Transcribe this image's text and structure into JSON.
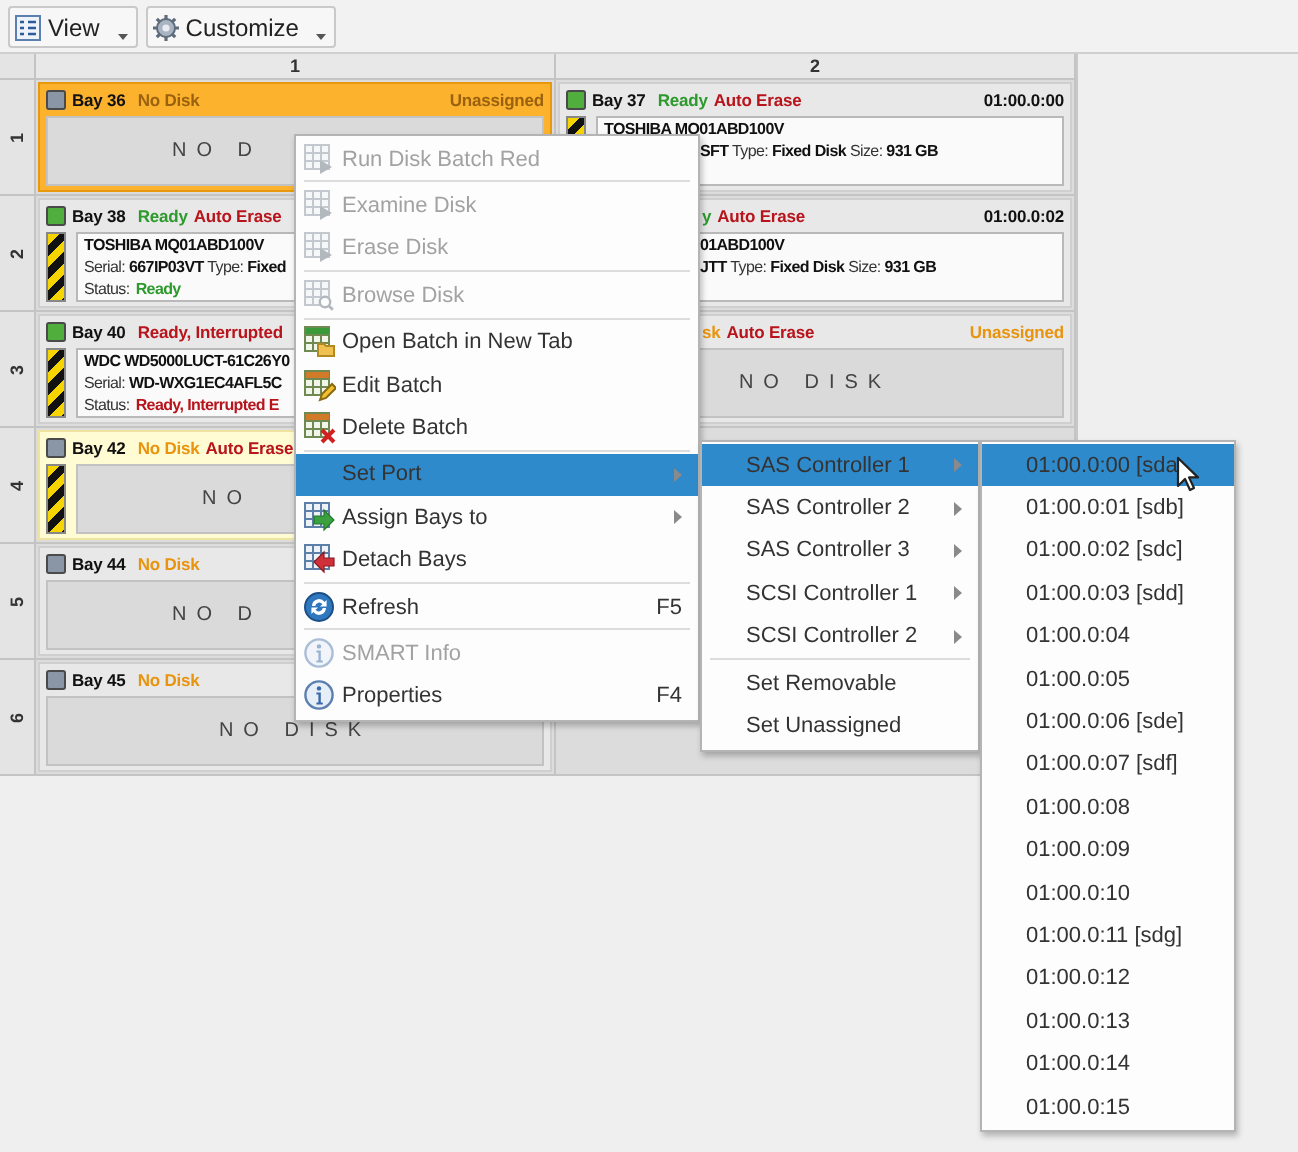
{
  "toolbar": {
    "buttons": [
      {
        "label": "View",
        "kind": "list",
        "has_dropdown": true
      },
      {
        "label": "Customize",
        "kind": "gear",
        "has_dropdown": true
      }
    ]
  },
  "grid": {
    "columns": [
      "1",
      "2"
    ],
    "rows": [
      {
        "label": "1",
        "cells": [
          {
            "selected": true,
            "highlighted": false,
            "color": "#8a96a6",
            "bay": "Bay 36",
            "status": [
              {
                "text": "No Disk",
                "color": "#9a6210"
              }
            ],
            "right": {
              "text": "Unassigned",
              "color": "#9a6210"
            },
            "striped": false,
            "body": {
              "kind": "empty",
              "label": "NO D"
            }
          },
          {
            "selected": false,
            "highlighted": false,
            "color": "#4fae3c",
            "bay": "Bay 37",
            "status": [
              {
                "text": "Ready",
                "color": "#2d9a2d"
              },
              {
                "text": "Auto Erase",
                "color": "#b8141c"
              }
            ],
            "right": {
              "text": "01:00.0:00",
              "color": "#111111"
            },
            "striped": true,
            "body": {
              "kind": "disk",
              "model": "TOSHIBA MQ01ABD100V",
              "details": "**SFT** Type: **Fixed Disk**  Size: **931 GB**"
            }
          }
        ]
      },
      {
        "label": "2",
        "cells": [
          {
            "selected": false,
            "highlighted": false,
            "color": "#4fae3c",
            "bay": "Bay 38",
            "status": [
              {
                "text": "Ready",
                "color": "#2d9a2d"
              },
              {
                "text": "Auto Erase",
                "color": "#b8141c"
              }
            ],
            "striped": true,
            "body": {
              "kind": "disk",
              "model": "TOSHIBA MQ01ABD100V",
              "details": "Serial: **667IP03VT** Type: **Fixed**",
              "status_label": "Status:",
              "status_value": {
                "text": "Ready",
                "color": "#2d9a2d"
              }
            }
          },
          {
            "selected": false,
            "highlighted": false,
            "status": [
              {
                "text": "y",
                "color": "#2d9a2d"
              },
              {
                "text": "Auto Erase",
                "color": "#b8141c"
              }
            ],
            "right": {
              "text": "01:00.0:02",
              "color": "#111111"
            },
            "striped": false,
            "body": {
              "kind": "disk",
              "model": "01ABD100V",
              "details": "**JTT** Type: **Fixed Disk**  Size: **931 GB**"
            }
          }
        ]
      },
      {
        "label": "3",
        "cells": [
          {
            "selected": false,
            "highlighted": false,
            "color": "#4fae3c",
            "bay": "Bay 40",
            "status": [
              {
                "text": "Ready, Interrupted",
                "color": "#b8141c"
              }
            ],
            "striped": true,
            "body": {
              "kind": "disk",
              "model": "WDC WD5000LUCT-61C26Y0",
              "details": "Serial: **WD-WXG1EC4AFL5C**",
              "status_label": "Status:",
              "status_value": {
                "text": "Ready, Interrupted E",
                "color": "#b8141c"
              }
            }
          },
          {
            "selected": false,
            "highlighted": false,
            "status": [
              {
                "text": "sk",
                "color": "#e8940e"
              },
              {
                "text": "Auto Erase",
                "color": "#b8141c"
              }
            ],
            "right": {
              "text": "Unassigned",
              "color": "#e8940e"
            },
            "striped": false,
            "body": {
              "kind": "empty",
              "label": "NO DISK"
            }
          }
        ]
      },
      {
        "label": "4",
        "cells": [
          {
            "selected": false,
            "highlighted": true,
            "color": "#8a96a6",
            "bay": "Bay 42",
            "status": [
              {
                "text": "No Disk",
                "color": "#e8940e"
              },
              {
                "text": "Auto Erase",
                "color": "#b8141c"
              }
            ],
            "striped": true,
            "body": {
              "kind": "empty",
              "label": "NO"
            }
          }
        ]
      },
      {
        "label": "5",
        "cells": [
          {
            "selected": false,
            "highlighted": false,
            "color": "#8a96a6",
            "bay": "Bay 44",
            "status": [
              {
                "text": "No Disk",
                "color": "#e8940e"
              }
            ],
            "striped": false,
            "body": {
              "kind": "empty",
              "label": "NO D"
            }
          }
        ]
      },
      {
        "label": "6",
        "cells": [
          {
            "selected": false,
            "highlighted": false,
            "color": "#8a96a6",
            "bay": "Bay 45",
            "status": [
              {
                "text": "No Disk",
                "color": "#e8940e"
              }
            ],
            "striped": false,
            "body": {
              "kind": "empty",
              "label": "NO DISK"
            }
          }
        ]
      }
    ]
  },
  "context_menu": {
    "items": [
      {
        "kind": "play",
        "label": "Run Disk Batch Red",
        "disabled": true,
        "selected": false,
        "has_submenu": false
      },
      {
        "kind": "separator"
      },
      {
        "kind": "play",
        "label": "Examine Disk",
        "disabled": true,
        "selected": false,
        "has_submenu": false
      },
      {
        "kind": "play",
        "label": "Erase Disk",
        "disabled": true,
        "selected": false,
        "has_submenu": false
      },
      {
        "kind": "separator"
      },
      {
        "kind": "browse",
        "label": "Browse Disk",
        "disabled": true,
        "selected": false,
        "has_submenu": false
      },
      {
        "kind": "separator"
      },
      {
        "kind": "folder",
        "label": "Open Batch in New Tab",
        "disabled": false,
        "selected": false,
        "has_submenu": false
      },
      {
        "kind": "pencil",
        "label": "Edit Batch",
        "disabled": false,
        "selected": false,
        "has_submenu": false
      },
      {
        "kind": "delete",
        "label": "Delete Batch",
        "disabled": false,
        "selected": false,
        "has_submenu": false
      },
      {
        "kind": "separator"
      },
      {
        "kind": "plain",
        "label": "Set Port",
        "disabled": false,
        "selected": true,
        "has_submenu": true
      },
      {
        "kind": "assign",
        "label": "Assign Bays to",
        "disabled": false,
        "selected": false,
        "has_submenu": true
      },
      {
        "kind": "detach",
        "label": "Detach Bays",
        "disabled": false,
        "selected": false,
        "has_submenu": false
      },
      {
        "kind": "separator"
      },
      {
        "kind": "refresh",
        "label": "Refresh",
        "shortcut": "F5",
        "disabled": false,
        "selected": false,
        "has_submenu": false
      },
      {
        "kind": "separator"
      },
      {
        "kind": "info",
        "label": "SMART Info",
        "disabled": true,
        "selected": false,
        "has_submenu": false
      },
      {
        "kind": "info",
        "label": "Properties",
        "shortcut": "F4",
        "disabled": false,
        "selected": false,
        "has_submenu": false
      }
    ]
  },
  "port_submenu": {
    "items": [
      {
        "kind": "plain",
        "label": "SAS Controller 1",
        "disabled": false,
        "selected": true,
        "has_submenu": true
      },
      {
        "kind": "plain",
        "label": "SAS Controller 2",
        "disabled": false,
        "selected": false,
        "has_submenu": true
      },
      {
        "kind": "plain",
        "label": "SAS Controller 3",
        "disabled": false,
        "selected": false,
        "has_submenu": true
      },
      {
        "kind": "plain",
        "label": "SCSI Controller 1",
        "disabled": false,
        "selected": false,
        "has_submenu": true
      },
      {
        "kind": "plain",
        "label": "SCSI Controller 2",
        "disabled": false,
        "selected": false,
        "has_submenu": true
      },
      {
        "kind": "separator"
      },
      {
        "kind": "plain",
        "label": "Set Removable",
        "disabled": false,
        "selected": false,
        "has_submenu": false
      },
      {
        "kind": "plain",
        "label": "Set Unassigned",
        "disabled": false,
        "selected": false,
        "has_submenu": false
      }
    ]
  },
  "controller_submenu": {
    "items": [
      {
        "kind": "plain",
        "label": "01:00.0:00 [sda",
        "disabled": false,
        "selected": true,
        "has_submenu": false
      },
      {
        "kind": "plain",
        "label": "01:00.0:01 [sdb]",
        "disabled": false,
        "selected": false,
        "has_submenu": false
      },
      {
        "kind": "plain",
        "label": "01:00.0:02 [sdc]",
        "disabled": false,
        "selected": false,
        "has_submenu": false
      },
      {
        "kind": "plain",
        "label": "01:00.0:03 [sdd]",
        "disabled": false,
        "selected": false,
        "has_submenu": false
      },
      {
        "kind": "plain",
        "label": "01:00.0:04",
        "disabled": false,
        "selected": false,
        "has_submenu": false
      },
      {
        "kind": "plain",
        "label": "01:00.0:05",
        "disabled": false,
        "selected": false,
        "has_submenu": false
      },
      {
        "kind": "plain",
        "label": "01:00.0:06 [sde]",
        "disabled": false,
        "selected": false,
        "has_submenu": false
      },
      {
        "kind": "plain",
        "label": "01:00.0:07 [sdf]",
        "disabled": false,
        "selected": false,
        "has_submenu": false
      },
      {
        "kind": "plain",
        "label": "01:00.0:08",
        "disabled": false,
        "selected": false,
        "has_submenu": false
      },
      {
        "kind": "plain",
        "label": "01:00.0:09",
        "disabled": false,
        "selected": false,
        "has_submenu": false
      },
      {
        "kind": "plain",
        "label": "01:00.0:10",
        "disabled": false,
        "selected": false,
        "has_submenu": false
      },
      {
        "kind": "plain",
        "label": "01:00.0:11 [sdg]",
        "disabled": false,
        "selected": false,
        "has_submenu": false
      },
      {
        "kind": "plain",
        "label": "01:00.0:12",
        "disabled": false,
        "selected": false,
        "has_submenu": false
      },
      {
        "kind": "plain",
        "label": "01:00.0:13",
        "disabled": false,
        "selected": false,
        "has_submenu": false
      },
      {
        "kind": "plain",
        "label": "01:00.0:14",
        "disabled": false,
        "selected": false,
        "has_submenu": false
      },
      {
        "kind": "plain",
        "label": "01:00.0:15",
        "disabled": false,
        "selected": false,
        "has_submenu": false
      }
    ]
  }
}
